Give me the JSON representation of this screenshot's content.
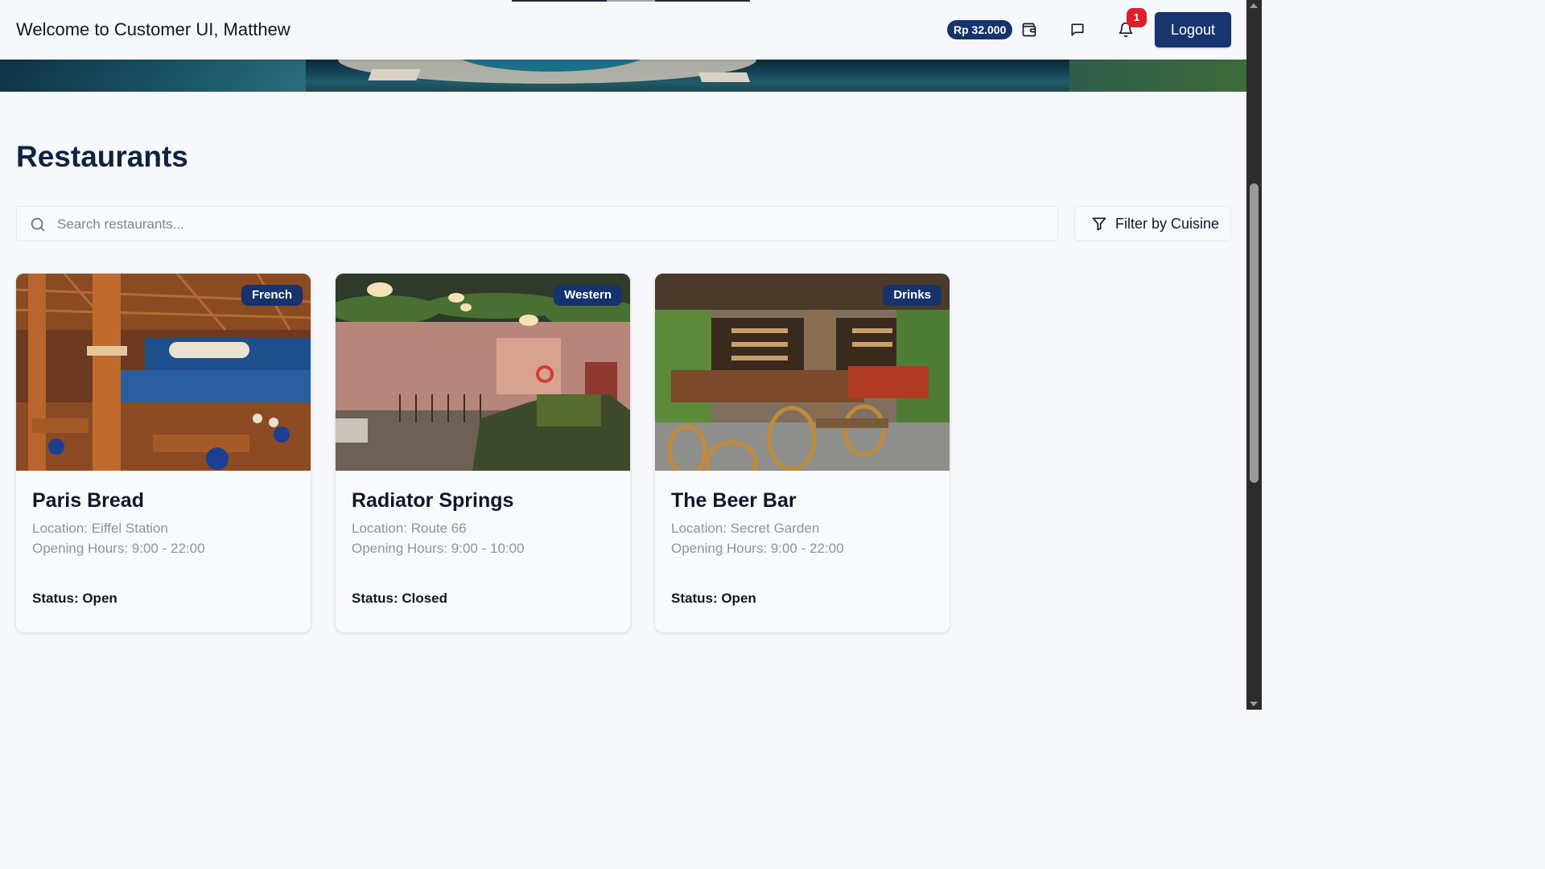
{
  "header": {
    "welcome": "Welcome to Customer UI, Matthew",
    "balance": "Rp 32.000",
    "notification_count": "1",
    "logout_label": "Logout",
    "icons": [
      "wallet-icon",
      "chat-icon",
      "bell-icon"
    ]
  },
  "main": {
    "title": "Restaurants",
    "search_placeholder": "Search restaurants...",
    "filter_label": "Filter by Cuisine"
  },
  "restaurants": [
    {
      "name": "Paris Bread",
      "cuisine": "French",
      "location": "Location: Eiffel Station",
      "hours": "Opening Hours: 9:00 - 22:00",
      "status": "Status: Open"
    },
    {
      "name": "Radiator Springs",
      "cuisine": "Western",
      "location": "Location: Route 66",
      "hours": "Opening Hours: 9:00 - 10:00",
      "status": "Status: Closed"
    },
    {
      "name": "The Beer Bar",
      "cuisine": "Drinks",
      "location": "Location: Secret Garden",
      "hours": "Opening Hours: 9:00 - 22:00",
      "status": "Status: Open"
    }
  ],
  "colors": {
    "brand": "#16336b",
    "badge": "#e11d2a",
    "background": "#f6f8fb"
  }
}
